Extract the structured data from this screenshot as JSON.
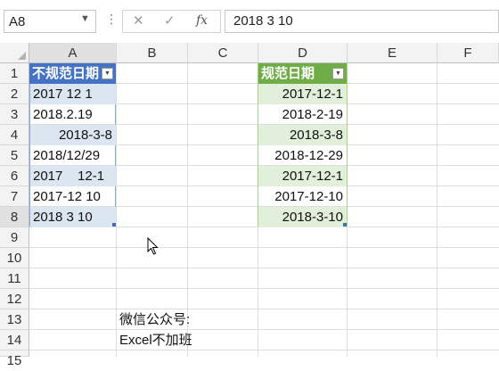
{
  "formula_bar": {
    "name_box": "A8",
    "dots": "⋮",
    "cancel_icon": "✕",
    "enter_icon": "✓",
    "fx_label": "fx",
    "value": "2018 3 10"
  },
  "columns": [
    "A",
    "B",
    "C",
    "D",
    "E",
    "F"
  ],
  "rows": [
    "1",
    "2",
    "3",
    "4",
    "5",
    "6",
    "7",
    "8",
    "9",
    "10",
    "11",
    "12",
    "13",
    "14",
    "15"
  ],
  "table_a": {
    "header": "不规范日期",
    "values": [
      "2017 12 1",
      "2018.2.19",
      "2018-3-8",
      "2018/12/29",
      "2017    12-1",
      "2017-12 10",
      "2018 3 10"
    ],
    "header_color": "#4472c4",
    "band_color": "#dce6f1"
  },
  "table_d": {
    "header": "规范日期",
    "values": [
      "2017-12-1",
      "2018-2-19",
      "2018-3-8",
      "2018-12-29",
      "2017-12-1",
      "2017-12-10",
      "2018-3-10"
    ],
    "header_color": "#70ad47",
    "band_color": "#e2efda"
  },
  "notes": {
    "b13": "微信公众号:",
    "b14": "Excel不加班"
  }
}
